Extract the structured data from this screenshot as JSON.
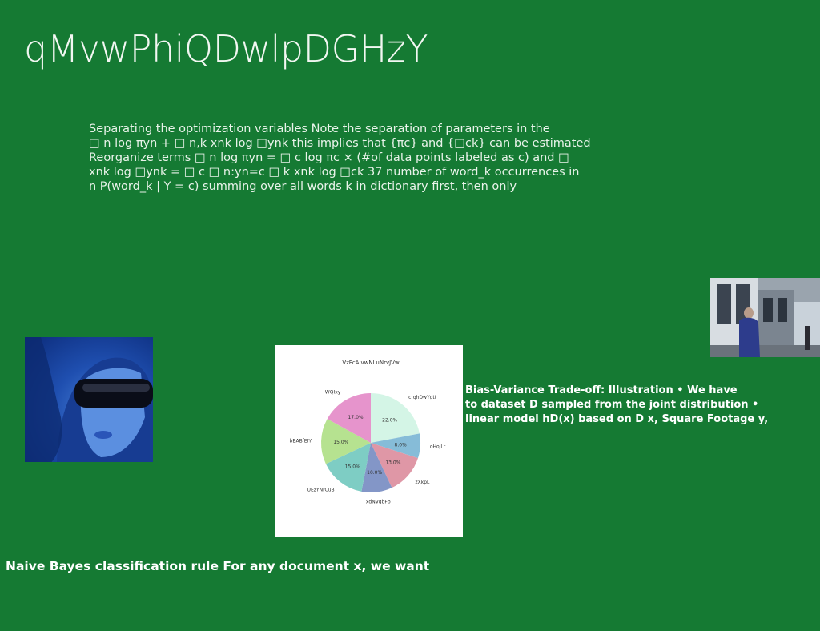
{
  "title": "qMvwPhiQDwlpDGHzY",
  "paragraph": {
    "lines": [
      "Separating the optimization variables Note the separation of parameters in the",
      "□ n log πyn + □ n,k xnk log □ynk this implies that {πc} and {□ck} can be estimated",
      "Reorganize terms □ n log πyn = □ c log πc × (#of data points labeled as c) and □",
      "xnk log □ynk = □ c □ n:yn=c □ k xnk log □ck 37 number of word_k occurrences in",
      "n P(word_k | Y = c) summing over all words k in dictionary first, then only"
    ]
  },
  "bias_text": {
    "lines": [
      "Bias-Variance Trade-off: Illustration • We have",
      "to dataset D sampled from the joint distribution •",
      "linear model hD(x) based on D x, Square Footage y,"
    ]
  },
  "bayes_text": "Naive Bayes classification rule For any document x, we want",
  "images": {
    "left_photo": "woman-with-vr-headset-photo",
    "right_photo": "street-scene-photo"
  },
  "chart_data": {
    "type": "pie",
    "title": "VzFcAIvwNLuNrvJVw",
    "slices": [
      {
        "label": "crqhDwYgtt",
        "value": 22.0,
        "color": "#d4f5e6"
      },
      {
        "label": "oHojLr",
        "value": 8.0,
        "color": "#86bcd8"
      },
      {
        "label": "zXkpL",
        "value": 13.0,
        "color": "#df97a6"
      },
      {
        "label": "xdNVgbFb",
        "value": 10.0,
        "color": "#8396c7"
      },
      {
        "label": "UEzYNrCuB",
        "value": 15.0,
        "color": "#7ecdc4"
      },
      {
        "label": "bBABfEIY",
        "value": 15.0,
        "color": "#b6e290"
      },
      {
        "label": "WQIxy",
        "value": 17.0,
        "color": "#e694cc"
      }
    ],
    "start_angle": "top",
    "direction": "clockwise",
    "value_labels": [
      "22.0%",
      "8.0%",
      "13.0%",
      "10.0%",
      "15.0%",
      "15.0%",
      "17.0%"
    ]
  }
}
